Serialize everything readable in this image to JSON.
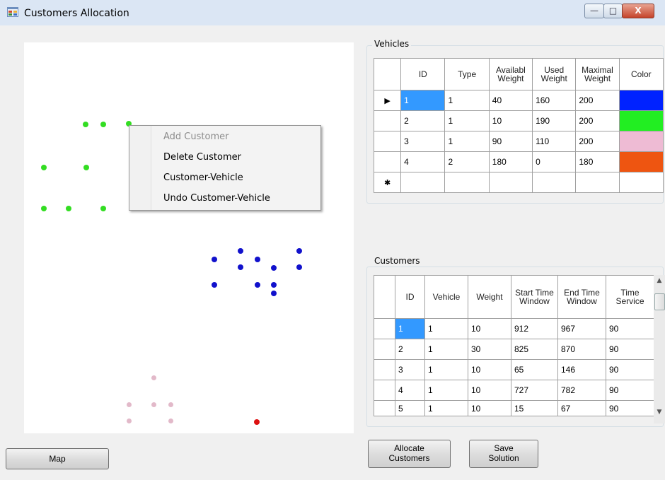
{
  "window": {
    "title": "Customers Allocation",
    "controls": {
      "minimize": "—",
      "maximize": "□",
      "close": "X"
    }
  },
  "context_menu": {
    "items": [
      {
        "label": "Add Customer",
        "enabled": false
      },
      {
        "label": "Delete Customer",
        "enabled": true
      },
      {
        "label": "Customer-Vehicle",
        "enabled": true
      },
      {
        "label": "Undo Customer-Vehicle",
        "enabled": true
      }
    ]
  },
  "vehicles": {
    "group_label": "Vehicles",
    "headers": {
      "id": "ID",
      "type": "Type",
      "available": "Availabl Weight",
      "used": "Used Weight",
      "maximal": "Maximal Weight",
      "color": "Color"
    },
    "current_row_marker": "▶",
    "new_row_marker": "✱",
    "rows": [
      {
        "id": "1",
        "type": "1",
        "available": "40",
        "used": "160",
        "maximal": "200",
        "color": "#0022ff"
      },
      {
        "id": "2",
        "type": "1",
        "available": "10",
        "used": "190",
        "maximal": "200",
        "color": "#22ee22"
      },
      {
        "id": "3",
        "type": "1",
        "available": "90",
        "used": "110",
        "maximal": "200",
        "color": "#eebbd4"
      },
      {
        "id": "4",
        "type": "2",
        "available": "180",
        "used": "0",
        "maximal": "180",
        "color": "#ee5511"
      }
    ]
  },
  "customers": {
    "group_label": "Customers",
    "headers": {
      "id": "ID",
      "vehicle": "Vehicle",
      "weight": "Weight",
      "start": "Start Time Window",
      "end": "End Time Window",
      "service": "Time Service"
    },
    "rows": [
      {
        "id": "1",
        "vehicle": "1",
        "weight": "10",
        "start": "912",
        "end": "967",
        "service": "90"
      },
      {
        "id": "2",
        "vehicle": "1",
        "weight": "30",
        "start": "825",
        "end": "870",
        "service": "90"
      },
      {
        "id": "3",
        "vehicle": "1",
        "weight": "10",
        "start": "65",
        "end": "146",
        "service": "90"
      },
      {
        "id": "4",
        "vehicle": "1",
        "weight": "10",
        "start": "727",
        "end": "782",
        "service": "90"
      },
      {
        "id": "5",
        "vehicle": "1",
        "weight": "10",
        "start": "15",
        "end": "67",
        "service": "90"
      }
    ]
  },
  "buttons": {
    "map": "Map",
    "allocate_line1": "Allocate",
    "allocate_line2": "Customers",
    "save_line1": "Save",
    "save_line2": "Solution"
  },
  "colors": {
    "green_customers": "#33dd22",
    "blue_customers": "#1111cc",
    "pink_customers": "#e2b9c9",
    "red_customer": "#dd1111",
    "selection": "#3399ff"
  }
}
